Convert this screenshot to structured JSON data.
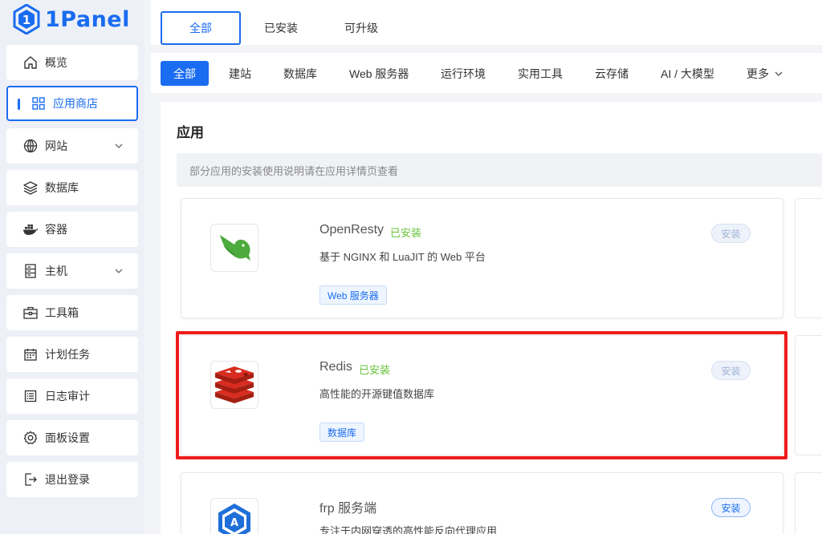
{
  "app": {
    "logo_text": "1Panel",
    "accent": "#1a6cf0"
  },
  "sidebar": {
    "items": [
      {
        "label": "概览",
        "icon": "home-icon"
      },
      {
        "label": "应用商店",
        "icon": "apps-grid-icon",
        "active": true
      },
      {
        "label": "网站",
        "icon": "globe-icon",
        "has_submenu": true
      },
      {
        "label": "数据库",
        "icon": "layers-icon"
      },
      {
        "label": "容器",
        "icon": "docker-icon"
      },
      {
        "label": "主机",
        "icon": "server-icon",
        "has_submenu": true
      },
      {
        "label": "工具箱",
        "icon": "toolbox-icon"
      },
      {
        "label": "计划任务",
        "icon": "calendar-icon"
      },
      {
        "label": "日志审计",
        "icon": "log-icon"
      },
      {
        "label": "面板设置",
        "icon": "gear-icon"
      },
      {
        "label": "退出登录",
        "icon": "logout-icon"
      }
    ]
  },
  "top_tabs": [
    {
      "label": "全部",
      "active": true
    },
    {
      "label": "已安装"
    },
    {
      "label": "可升级"
    }
  ],
  "categories": [
    {
      "label": "全部",
      "active": true
    },
    {
      "label": "建站"
    },
    {
      "label": "数据库"
    },
    {
      "label": "Web 服务器"
    },
    {
      "label": "运行环境"
    },
    {
      "label": "实用工具"
    },
    {
      "label": "云存储"
    },
    {
      "label": "AI / 大模型"
    },
    {
      "label": "更多"
    }
  ],
  "main": {
    "title": "应用",
    "notice": "部分应用的安装使用说明请在应用详情页查看",
    "apps": [
      {
        "name": "OpenResty",
        "status": "已安装",
        "description": "基于 NGINX 和 LuaJIT 的 Web 平台",
        "tag": "Web 服务器",
        "install_label": "安装",
        "icon": "openresty-logo"
      },
      {
        "name": "Redis",
        "status": "已安装",
        "description": "高性能的开源键值数据库",
        "tag": "数据库",
        "install_label": "安装",
        "icon": "redis-logo"
      },
      {
        "name": "frp 服务端",
        "status": "",
        "description": "专注于内网穿透的高性能反向代理应用",
        "tag": "",
        "install_label": "安装",
        "icon": "frp-logo"
      }
    ]
  },
  "colors": {
    "installed_green": "#67c23a",
    "highlight_red": "#ee1b1b"
  }
}
